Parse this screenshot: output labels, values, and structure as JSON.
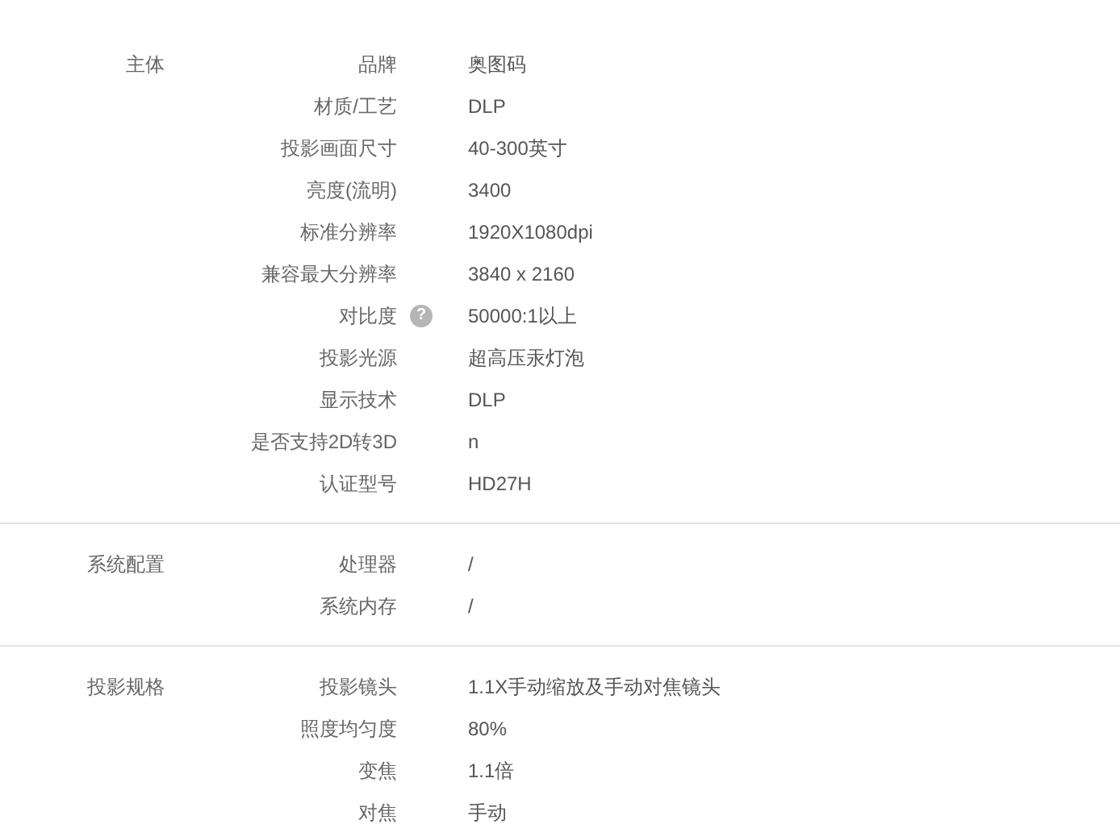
{
  "sections": [
    {
      "title": "主体",
      "rows": [
        {
          "label": "品牌",
          "value": "奥图码"
        },
        {
          "label": "材质/工艺",
          "value": "DLP"
        },
        {
          "label": "投影画面尺寸",
          "value": "40-300英寸"
        },
        {
          "label": "亮度(流明)",
          "value": "3400"
        },
        {
          "label": "标准分辨率",
          "value": "1920X1080dpi"
        },
        {
          "label": "兼容最大分辨率",
          "value": "3840 x 2160"
        },
        {
          "label": "对比度",
          "hint": "?",
          "value": "50000:1以上"
        },
        {
          "label": "投影光源",
          "value": "超高压汞灯泡"
        },
        {
          "label": "显示技术",
          "value": "DLP"
        },
        {
          "label": "是否支持2D转3D",
          "value": "n"
        },
        {
          "label": "认证型号",
          "value": "HD27H"
        }
      ]
    },
    {
      "title": "系统配置",
      "rows": [
        {
          "label": "处理器",
          "value": "/"
        },
        {
          "label": "系统内存",
          "value": "/"
        }
      ]
    },
    {
      "title": "投影规格",
      "rows": [
        {
          "label": "投影镜头",
          "value": "1.1X手动缩放及手动对焦镜头"
        },
        {
          "label": "照度均匀度",
          "value": "80%"
        },
        {
          "label": "变焦",
          "value": "1.1倍"
        },
        {
          "label": "对焦",
          "value": "手动"
        }
      ]
    }
  ]
}
